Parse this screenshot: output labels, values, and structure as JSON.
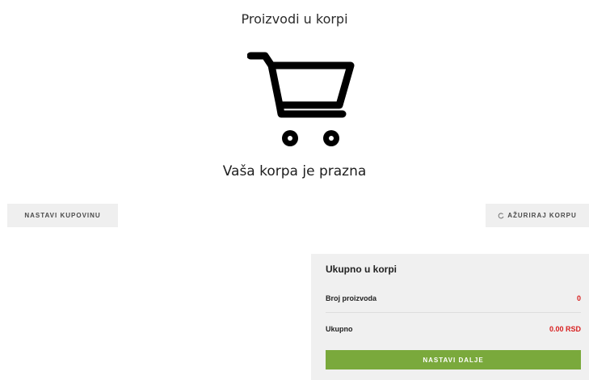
{
  "page": {
    "title": "Proizvodi u korpi",
    "empty_message": "Vaša korpa je prazna"
  },
  "icons": {
    "cart": "shopping-cart-icon",
    "refresh": "refresh-icon"
  },
  "actions": {
    "continue_shopping": "NASTAVI KUPOVINU",
    "update_cart": "AŽURIRAJ KORPU"
  },
  "summary": {
    "title": "Ukupno u korpi",
    "rows": [
      {
        "label": "Broj proizvoda",
        "value": "0"
      },
      {
        "label": "Ukupno",
        "value": "0.00 RSD"
      }
    ],
    "next_label": "NASTAVI DALJE"
  },
  "colors": {
    "accent_green": "#7aa93c",
    "price_red": "#d81f1f",
    "button_bg": "#efefef",
    "summary_bg": "#f0f0f0"
  }
}
